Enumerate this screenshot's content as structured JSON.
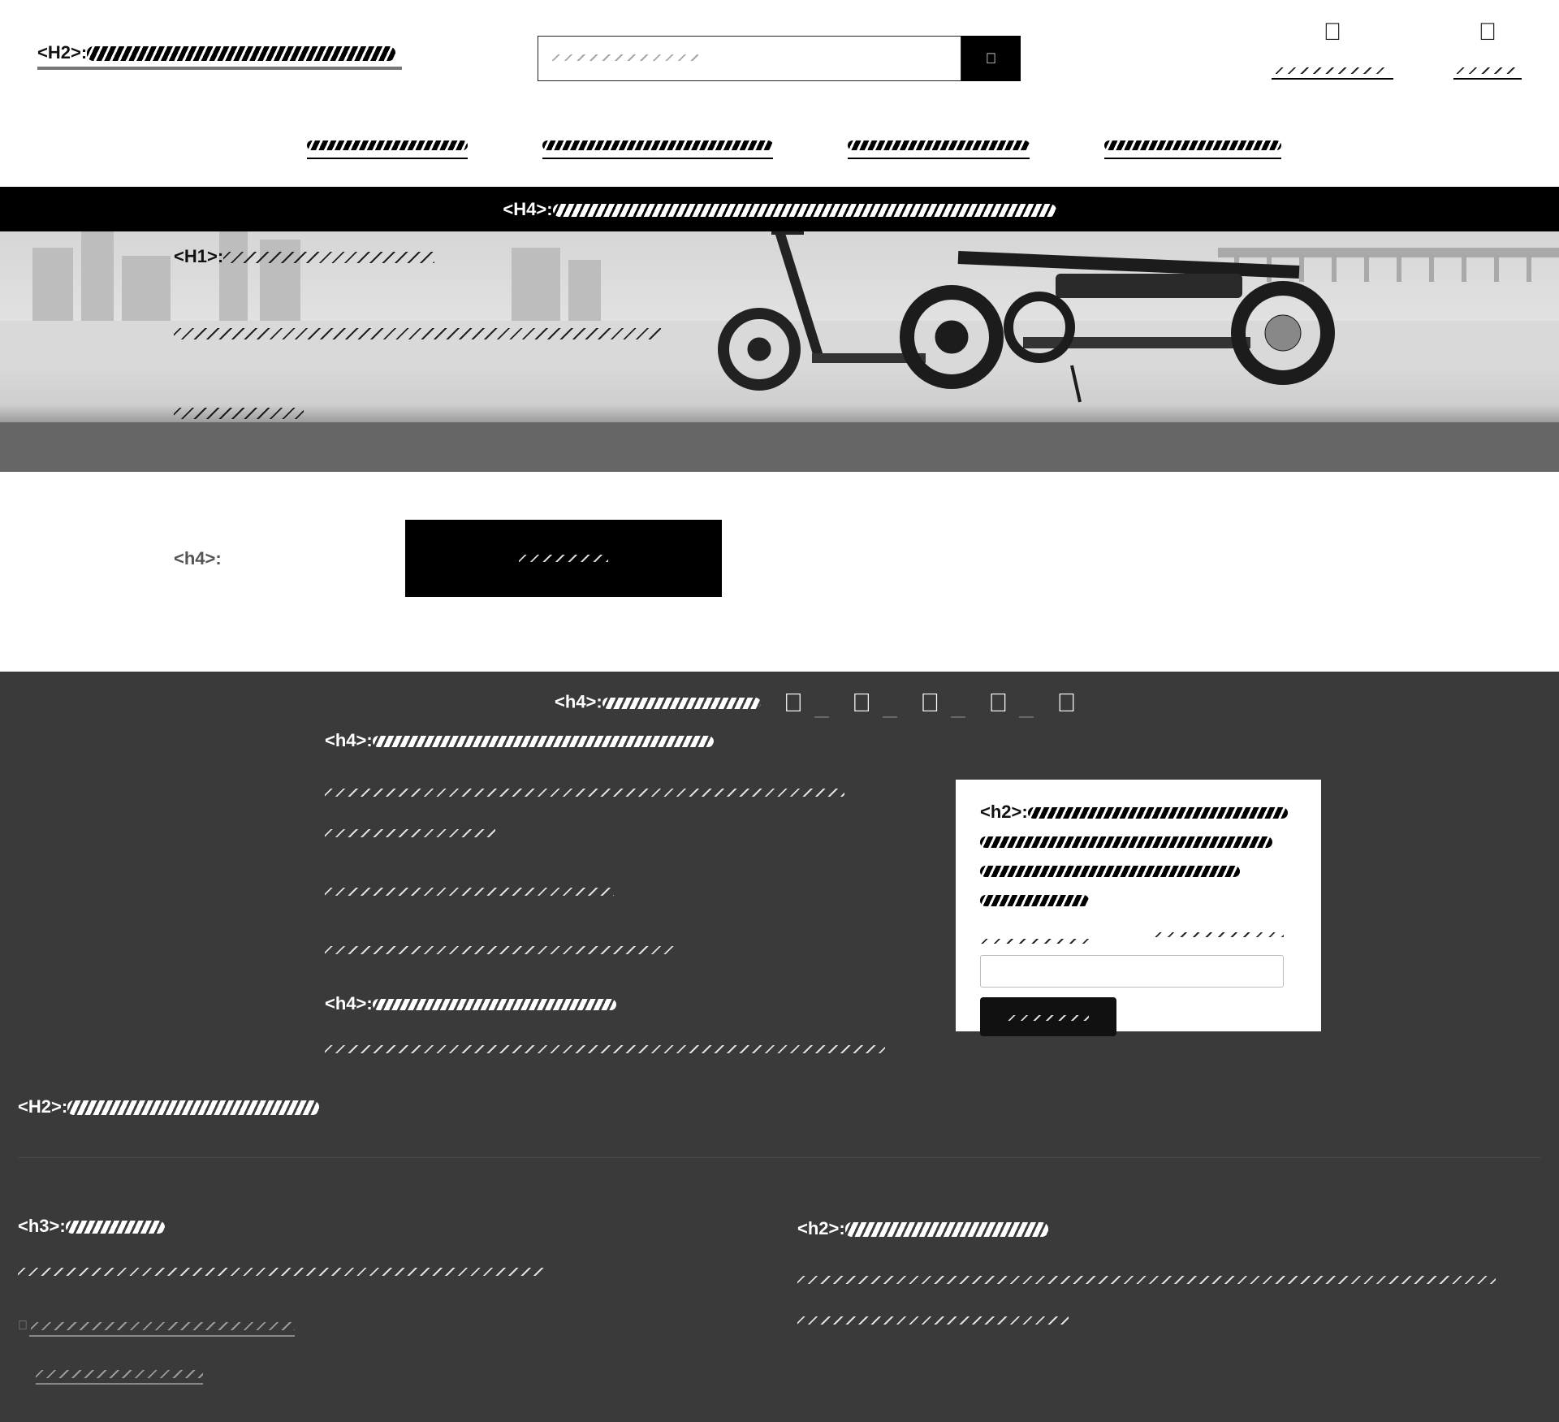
{
  "header": {
    "brand_tag": "<H2>:",
    "search_placeholder": "",
    "search_icon": "search-icon",
    "account_icon": "user-icon",
    "cart_icon": "cart-icon",
    "icon_glyph": "",
    "search_glyph": ""
  },
  "announcement": {
    "tag": "<H4>:"
  },
  "hero": {
    "heading_tag": "<H1>:"
  },
  "cta": {
    "tag": "<h4>:"
  },
  "reviews": {
    "tag": "<h4>:",
    "star_glyph": ""
  },
  "about": {
    "heading_tag": "<h4>:"
  },
  "shop": {
    "heading_tag": "<h4>:"
  },
  "signup": {
    "title_tag": "<h2>:"
  },
  "footer": {
    "title_tag": "<H2>:",
    "contact_tag": "<h3>:",
    "policy_tag": "<h2>:",
    "link_icon": "link-icon",
    "link_glyph": ""
  },
  "colors": {
    "header_bg": "#ffffff",
    "announce_bg": "#000000",
    "dark_bg": "#3a3a3a",
    "button_bg": "#000000"
  }
}
